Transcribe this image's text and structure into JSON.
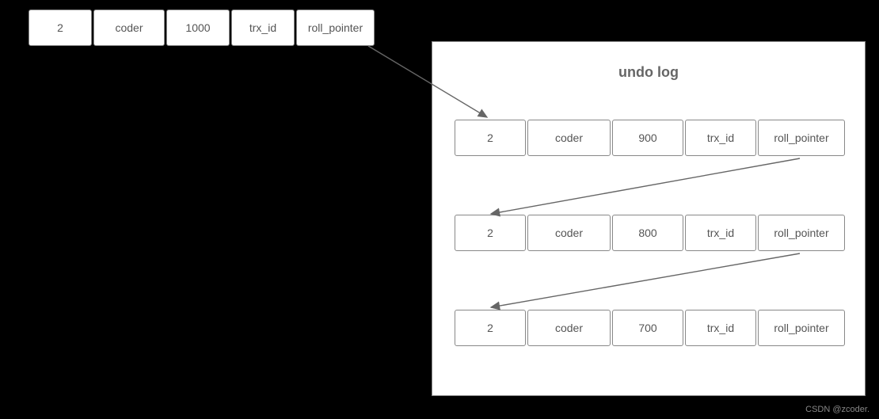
{
  "main_row": {
    "id": "2",
    "name": "coder",
    "value": "1000",
    "trx": "trx_id",
    "roll": "roll_pointer"
  },
  "log": {
    "title": "undo log",
    "rows": [
      {
        "id": "2",
        "name": "coder",
        "value": "900",
        "trx": "trx_id",
        "roll": "roll_pointer"
      },
      {
        "id": "2",
        "name": "coder",
        "value": "800",
        "trx": "trx_id",
        "roll": "roll_pointer"
      },
      {
        "id": "2",
        "name": "coder",
        "value": "700",
        "trx": "trx_id",
        "roll": "roll_pointer"
      }
    ]
  },
  "watermark": "CSDN @zcoder."
}
